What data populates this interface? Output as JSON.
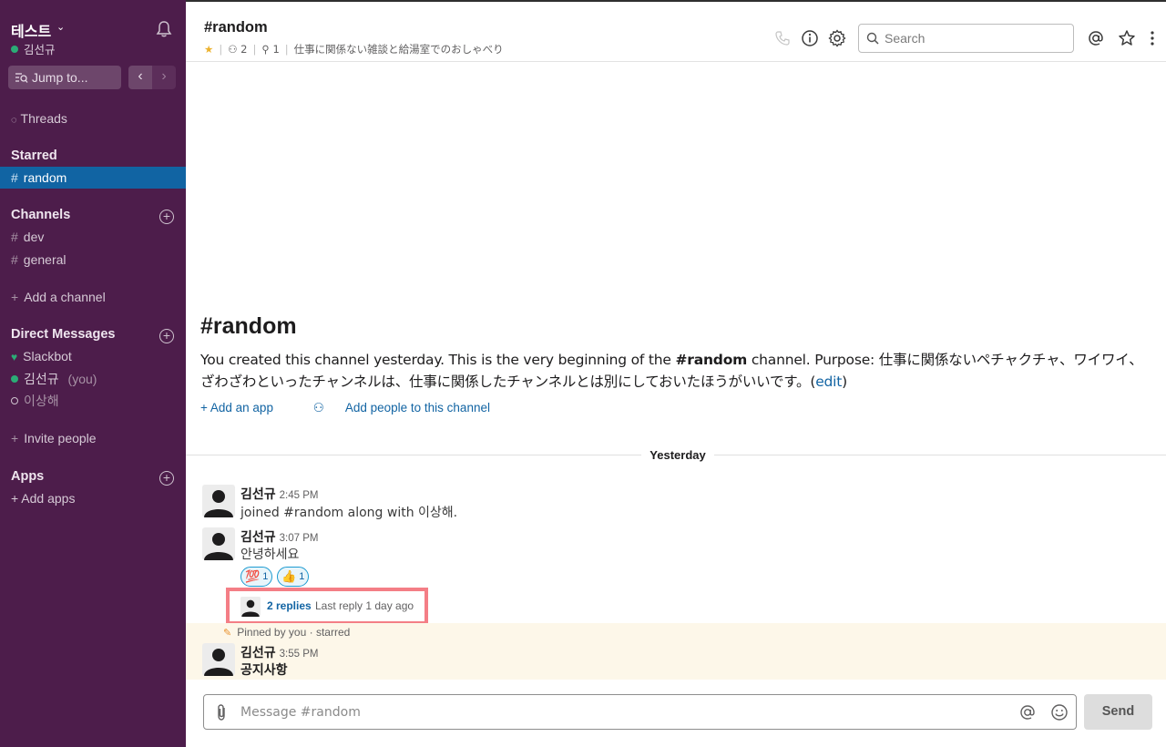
{
  "workspace": {
    "name": "테스트",
    "user": "김선규"
  },
  "sidebar": {
    "jump_label": "Jump to...",
    "threads_label": "Threads",
    "starred_title": "Starred",
    "starred": [
      {
        "label": "random"
      }
    ],
    "channels_title": "Channels",
    "channels": [
      {
        "label": "dev"
      },
      {
        "label": "general"
      }
    ],
    "add_channel_label": "Add a channel",
    "dm_title": "Direct Messages",
    "dms": [
      {
        "label": "Slackbot",
        "suffix": ""
      },
      {
        "label": "김선규",
        "suffix": "(you)"
      },
      {
        "label": "이상해",
        "suffix": ""
      }
    ],
    "invite_label": "Invite people",
    "apps_title": "Apps",
    "add_apps_label": "+ Add apps"
  },
  "header": {
    "channel": "#random",
    "members": "2",
    "pins": "1",
    "topic": "仕事に関係ない雑談と給湯室でのおしゃべり",
    "search_placeholder": "Search"
  },
  "intro": {
    "title": "#random",
    "text_prefix": "You created this channel yesterday. This is the very beginning of the ",
    "channel_bold": "#random",
    "text_mid": " channel. Purpose: 仕事に関係ないペチャクチャ、ワイワイ、ざわざわといったチャンネルは、仕事に関係したチャンネルとは別にしておいたほうがいいです。(",
    "edit": "edit",
    "text_suffix": ")",
    "add_app": "Add an app",
    "add_people": "Add people to this channel"
  },
  "day_divider": "Yesterday",
  "messages": [
    {
      "author": "김선규",
      "time": "2:45 PM",
      "text": "joined #random along with 이상해."
    },
    {
      "author": "김선규",
      "time": "3:07 PM",
      "text": "안녕하세요",
      "reactions": [
        {
          "emoji": "💯",
          "count": "1"
        },
        {
          "emoji": "👍",
          "count": "1"
        }
      ],
      "thread": {
        "replies": "2 replies",
        "last": "Last reply 1 day ago"
      }
    },
    {
      "pin_note": "Pinned by you · starred",
      "author": "김선규",
      "time": "3:55 PM",
      "text": "공지사항"
    }
  ],
  "composer": {
    "placeholder": "Message #random",
    "send": "Send"
  },
  "colors": {
    "sidebar": "#4d1d4b",
    "active": "#1164a3",
    "link": "#1264a3",
    "highlight": "#f47e86",
    "pinned": "#fdf7e9"
  },
  "icons": [
    "bell-icon",
    "jump-icon",
    "phone-icon",
    "info-icon",
    "gear-icon",
    "search-icon",
    "at-icon",
    "star-icon",
    "more-icon",
    "paperclip-icon",
    "emoji-icon",
    "person-icon",
    "pin-icon"
  ]
}
